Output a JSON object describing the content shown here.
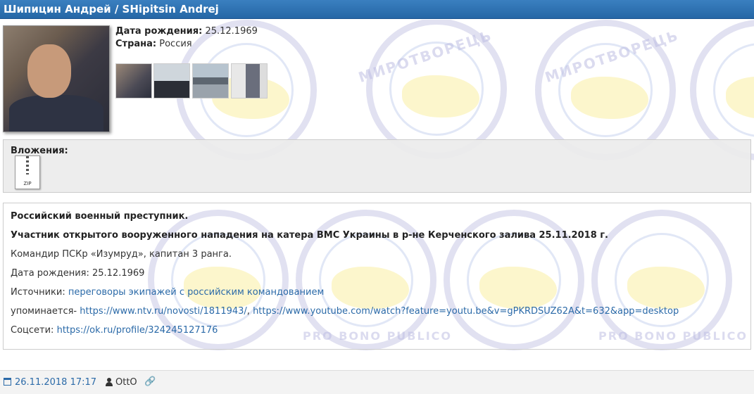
{
  "header": {
    "title": "Шипицин Андрей / SHipitsin Andrej"
  },
  "profile": {
    "birth_label": "Дата рождения:",
    "birth_value": "25.12.1969",
    "country_label": "Страна:",
    "country_value": "Россия"
  },
  "attachments": {
    "label": "Вложения:",
    "file_type": "ZIP"
  },
  "description": {
    "line1": "Российский военный преступник.",
    "line2": "Участник открытого вооруженного нападения на катера ВМС Украины в р-не Керченского залива 25.11.2018 г.",
    "line3": "Командир ПСКр «Изумруд», капитан 3 ранга.",
    "line4": "Дата рождения: 25.12.1969",
    "sources_label": "Источники:",
    "sources_link": "переговоры экипажей с российским командованием",
    "mentioned_label": "упоминается-",
    "mentioned_link1": "https://www.ntv.ru/novosti/1811943/",
    "mentioned_sep": ",",
    "mentioned_link2": "https://www.youtube.com/watch?feature=youtu.be&v=gPKRDSUZ62A&t=632&app=desktop",
    "social_label": "Соцсети:",
    "social_link": "https://ok.ru/profile/324245127176"
  },
  "footer": {
    "date": "26.11.2018 17:17",
    "author": "OttO"
  },
  "watermark": {
    "top_text": "МИРОТВОРЕЦЬ",
    "bottom_text": "PRO BONO PUBLICO"
  },
  "colors": {
    "header_bg": "#2d6fae",
    "link": "#2b6aa8"
  }
}
